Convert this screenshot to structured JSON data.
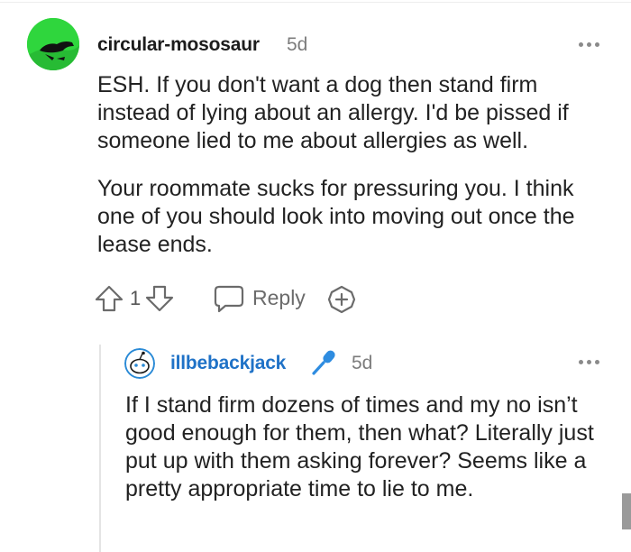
{
  "comment": {
    "username": "circular-mososaur",
    "age": "5d",
    "paragraphs": [
      "ESH. If you don't want a dog then stand firm instead of lying about an allergy. I'd be pissed if someone lied to me about allergies as well.",
      "Your roommate sucks for pressuring you. I think one of you should look into moving out once the lease ends."
    ],
    "actions": {
      "upvote_icon": "arrow-up-outline-icon",
      "score": "1",
      "downvote_icon": "arrow-down-outline-icon",
      "reply_icon": "speech-bubble-icon",
      "reply_label": "Reply",
      "award_icon": "plus-badge-icon"
    },
    "avatar_color": "#2fd63d"
  },
  "reply": {
    "username": "illbebackjack",
    "flair_icon": "microphone-icon",
    "age": "5d",
    "text": "If I stand firm dozens of times and my no isn’t good enough for them, then what? Literally just put up with them asking forever? Seems like a pretty appropriate time to lie to me.",
    "username_color": "#1f72c7"
  },
  "menu_icon": "more-dots-icon"
}
